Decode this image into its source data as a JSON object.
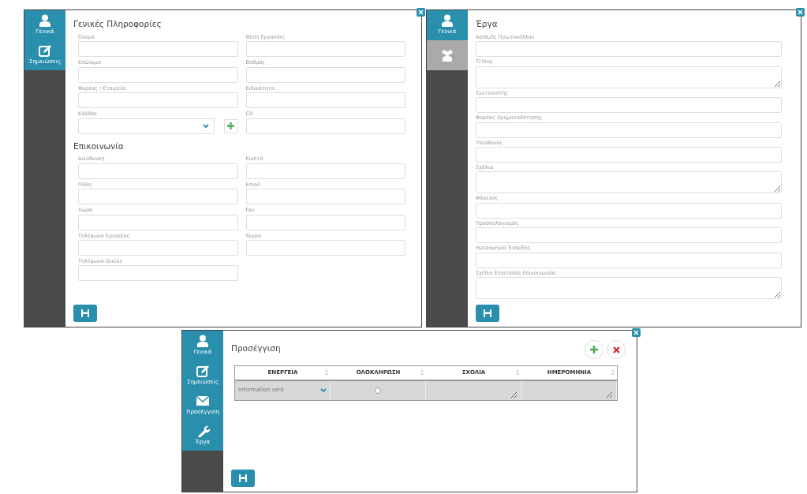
{
  "general_panel": {
    "sidebar": [
      {
        "label": "Γενικά",
        "kind": "general",
        "selected": false
      },
      {
        "label": "Σημειώσεις",
        "kind": "notes",
        "selected": false
      }
    ],
    "sections": [
      {
        "heading": "Γενικές Πληροφορίες",
        "fields": [
          {
            "label": "Όνομα",
            "kind": "text"
          },
          {
            "label": "Θέση Εργασίας",
            "kind": "text"
          },
          {
            "label": "Επώνυμο",
            "kind": "text"
          },
          {
            "label": "Βαθμός",
            "kind": "text"
          },
          {
            "label": "Φορέας / Εταιρεία",
            "kind": "text"
          },
          {
            "label": "Ειδικότητα",
            "kind": "text"
          },
          {
            "label": "Κλάδος",
            "kind": "select"
          },
          {
            "label": "CV",
            "kind": "text"
          }
        ]
      },
      {
        "heading": "Επικοινωνία",
        "fields": [
          {
            "label": "Διεύθυνση",
            "kind": "text"
          },
          {
            "label": "Κινητό",
            "kind": "text"
          },
          {
            "label": "Πόλη",
            "kind": "text"
          },
          {
            "label": "Email",
            "kind": "text"
          },
          {
            "label": "Χώρα",
            "kind": "text"
          },
          {
            "label": "Fax",
            "kind": "text"
          },
          {
            "label": "Τηλέφωνο Εργασίας",
            "kind": "text"
          },
          {
            "label": "Skype",
            "kind": "text"
          },
          {
            "label": "Τηλέφωνο Οικίας",
            "kind": "text"
          }
        ]
      }
    ]
  },
  "projects_panel": {
    "sidebar": [
      {
        "label": "Γενικά",
        "kind": "general",
        "selected": false
      },
      {
        "kind": "team",
        "selected": true
      }
    ],
    "title": "Έργα",
    "fields": [
      {
        "label": "Αριθμός Πρωτοκόλλου",
        "kind": "text"
      },
      {
        "label": "Τίτλος",
        "kind": "textarea"
      },
      {
        "label": "Συντονιστής",
        "kind": "text"
      },
      {
        "label": "Φορέας Χρηματοδότησης",
        "kind": "text"
      },
      {
        "label": "Υπεύθυνος",
        "kind": "text"
      },
      {
        "label": "Σχόλια",
        "kind": "textarea"
      },
      {
        "label": "Φάκελος",
        "kind": "text"
      },
      {
        "label": "Προϋπολογισμός",
        "kind": "text"
      },
      {
        "label": "Ημερομηνία Έναρξης",
        "kind": "text"
      },
      {
        "label": "Σχέδιο Επιστολής Επικοινωνίας",
        "kind": "textarea"
      }
    ]
  },
  "approach_panel": {
    "sidebar": [
      {
        "label": "Γενικά",
        "kind": "general",
        "selected": false
      },
      {
        "label": "Σημειώσεις",
        "kind": "notes",
        "selected": false
      },
      {
        "label": "Προσέγγιση",
        "kind": "approach",
        "selected": false
      },
      {
        "label": "Έργα",
        "kind": "projects",
        "selected": false
      }
    ],
    "title": "Προσέγγιση",
    "table": {
      "columns": [
        "ΕΝΕΡΓΕΙΑ",
        "ΟΛΟΚΛΗΡΩΣΗ",
        "ΣΧΟΛΙΑ",
        "ΗΜΕΡΟΜΗΝΙΑ"
      ],
      "rows": [
        {
          "action": "Information sent",
          "completed": false
        }
      ]
    }
  }
}
